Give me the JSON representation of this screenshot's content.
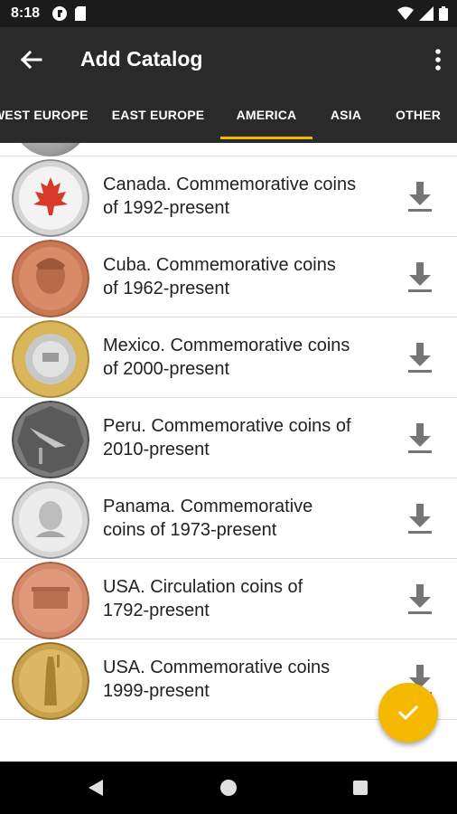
{
  "status_bar": {
    "time": "8:18"
  },
  "app_bar": {
    "title": "Add Catalog"
  },
  "tabs": [
    {
      "label": "WEST EUROPE",
      "active": false
    },
    {
      "label": "EAST EUROPE",
      "active": false
    },
    {
      "label": "AMERICA",
      "active": true
    },
    {
      "label": "ASIA",
      "active": false
    },
    {
      "label": "OTHER",
      "active": false
    }
  ],
  "catalogs": [
    {
      "title": "Canada. Commemorative coins of 1992-present",
      "line1": "Canada. Commemorative coins",
      "line2": "of 1992-present"
    },
    {
      "title": "Cuba. Commemorative coins of 1962-present",
      "line1": "Cuba. Commemorative coins",
      "line2": "of 1962-present"
    },
    {
      "title": "Mexico. Commemorative coins of 2000-present",
      "line1": "Mexico. Commemorative coins",
      "line2": "of 2000-present"
    },
    {
      "title": "Peru. Commemorative coins of 2010-present",
      "line1": "Peru. Commemorative coins of",
      "line2": "2010-present"
    },
    {
      "title": "Panama. Commemorative coins of 1973-present",
      "line1": "Panama. Commemorative",
      "line2": "coins of 1973-present"
    },
    {
      "title": "USA. Circulation coins of 1792-present",
      "line1": "USA. Circulation coins of",
      "line2": "1792-present"
    },
    {
      "title": "USA. Commemorative coins 1999-present",
      "line1": "USA. Commemorative coins",
      "line2": "1999-present"
    }
  ],
  "colors": {
    "accent": "#f5b800",
    "app_bar": "#2a2a2a",
    "icon_gray": "#757575"
  },
  "icons": {
    "back": "arrow-back-icon",
    "more": "more-vert-icon",
    "download": "download-icon",
    "fab": "check-icon"
  }
}
